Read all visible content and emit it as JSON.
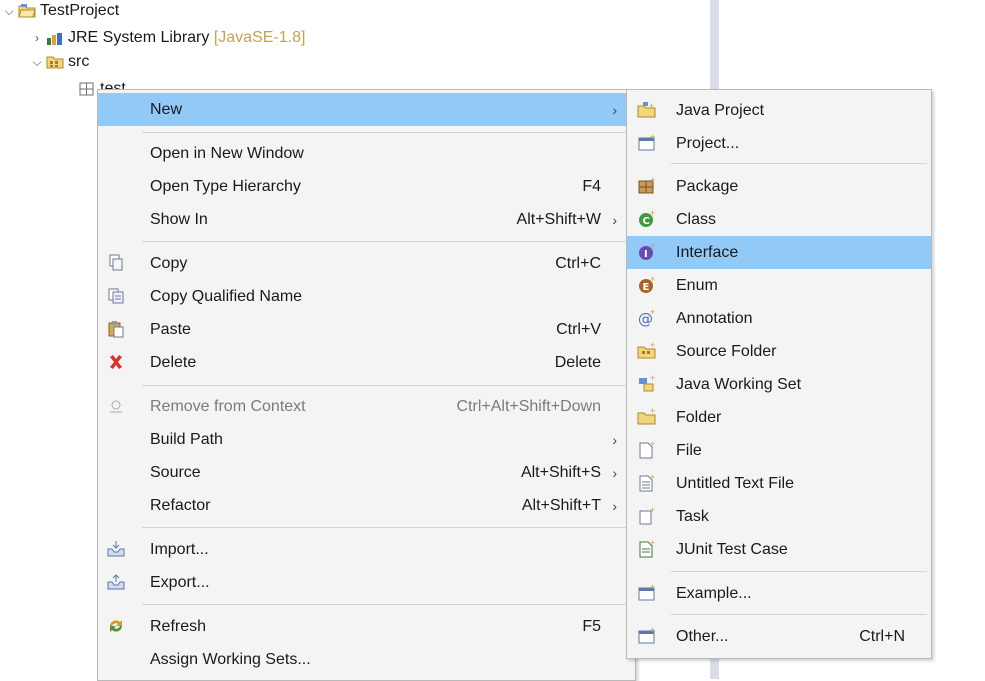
{
  "tree": {
    "project": "TestProject",
    "jre_label": "JRE System Library",
    "jre_version": "[JavaSE-1.8]",
    "src": "src",
    "package": "test"
  },
  "context_menu": [
    {
      "label": "New",
      "accelerator": "",
      "submenu": true,
      "highlighted": true,
      "icon": ""
    },
    {
      "label": "Open in New Window",
      "accelerator": "",
      "submenu": false,
      "icon": ""
    },
    {
      "label": "Open Type Hierarchy",
      "accelerator": "F4",
      "submenu": false,
      "icon": ""
    },
    {
      "label": "Show In",
      "accelerator": "Alt+Shift+W",
      "submenu": true,
      "icon": ""
    },
    {
      "label": "Copy",
      "accelerator": "Ctrl+C",
      "submenu": false,
      "icon": "copy-icon"
    },
    {
      "label": "Copy Qualified Name",
      "accelerator": "",
      "submenu": false,
      "icon": "copy-qualified-name-icon"
    },
    {
      "label": "Paste",
      "accelerator": "Ctrl+V",
      "submenu": false,
      "icon": "paste-icon"
    },
    {
      "label": "Delete",
      "accelerator": "Delete",
      "submenu": false,
      "icon": "delete-icon"
    },
    {
      "label": "Remove from Context",
      "accelerator": "Ctrl+Alt+Shift+Down",
      "submenu": false,
      "disabled": true,
      "icon": "remove-from-context-icon"
    },
    {
      "label": "Build Path",
      "accelerator": "",
      "submenu": true,
      "icon": ""
    },
    {
      "label": "Source",
      "accelerator": "Alt+Shift+S",
      "submenu": true,
      "icon": ""
    },
    {
      "label": "Refactor",
      "accelerator": "Alt+Shift+T",
      "submenu": true,
      "icon": ""
    },
    {
      "label": "Import...",
      "accelerator": "",
      "submenu": false,
      "icon": "import-icon"
    },
    {
      "label": "Export...",
      "accelerator": "",
      "submenu": false,
      "icon": "export-icon"
    },
    {
      "label": "Refresh",
      "accelerator": "F5",
      "submenu": false,
      "icon": "refresh-icon"
    },
    {
      "label": "Assign Working Sets...",
      "accelerator": "",
      "submenu": false,
      "icon": ""
    }
  ],
  "new_submenu": [
    {
      "label": "Java Project",
      "accelerator": "",
      "icon": "java-project-icon"
    },
    {
      "label": "Project...",
      "accelerator": "",
      "icon": "project-icon"
    },
    {
      "label": "Package",
      "accelerator": "",
      "icon": "package-icon"
    },
    {
      "label": "Class",
      "accelerator": "",
      "icon": "class-icon"
    },
    {
      "label": "Interface",
      "accelerator": "",
      "icon": "interface-icon",
      "highlighted": true
    },
    {
      "label": "Enum",
      "accelerator": "",
      "icon": "enum-icon"
    },
    {
      "label": "Annotation",
      "accelerator": "",
      "icon": "annotation-icon"
    },
    {
      "label": "Source Folder",
      "accelerator": "",
      "icon": "source-folder-icon"
    },
    {
      "label": "Java Working Set",
      "accelerator": "",
      "icon": "java-working-set-icon"
    },
    {
      "label": "Folder",
      "accelerator": "",
      "icon": "folder-icon"
    },
    {
      "label": "File",
      "accelerator": "",
      "icon": "file-icon"
    },
    {
      "label": "Untitled Text File",
      "accelerator": "",
      "icon": "untitled-text-file-icon"
    },
    {
      "label": "Task",
      "accelerator": "",
      "icon": "task-icon"
    },
    {
      "label": "JUnit Test Case",
      "accelerator": "",
      "icon": "junit-test-case-icon"
    },
    {
      "label": "Example...",
      "accelerator": "",
      "icon": "example-icon"
    },
    {
      "label": "Other...",
      "accelerator": "Ctrl+N",
      "icon": "other-icon"
    }
  ],
  "colors": {
    "highlight": "#91c9f7",
    "menu_bg": "#f4f4f4",
    "class_green": "#3f9b3f",
    "interface_purple": "#6a4bb3",
    "enum_brown": "#a8652a",
    "delete_red": "#d6322f"
  }
}
